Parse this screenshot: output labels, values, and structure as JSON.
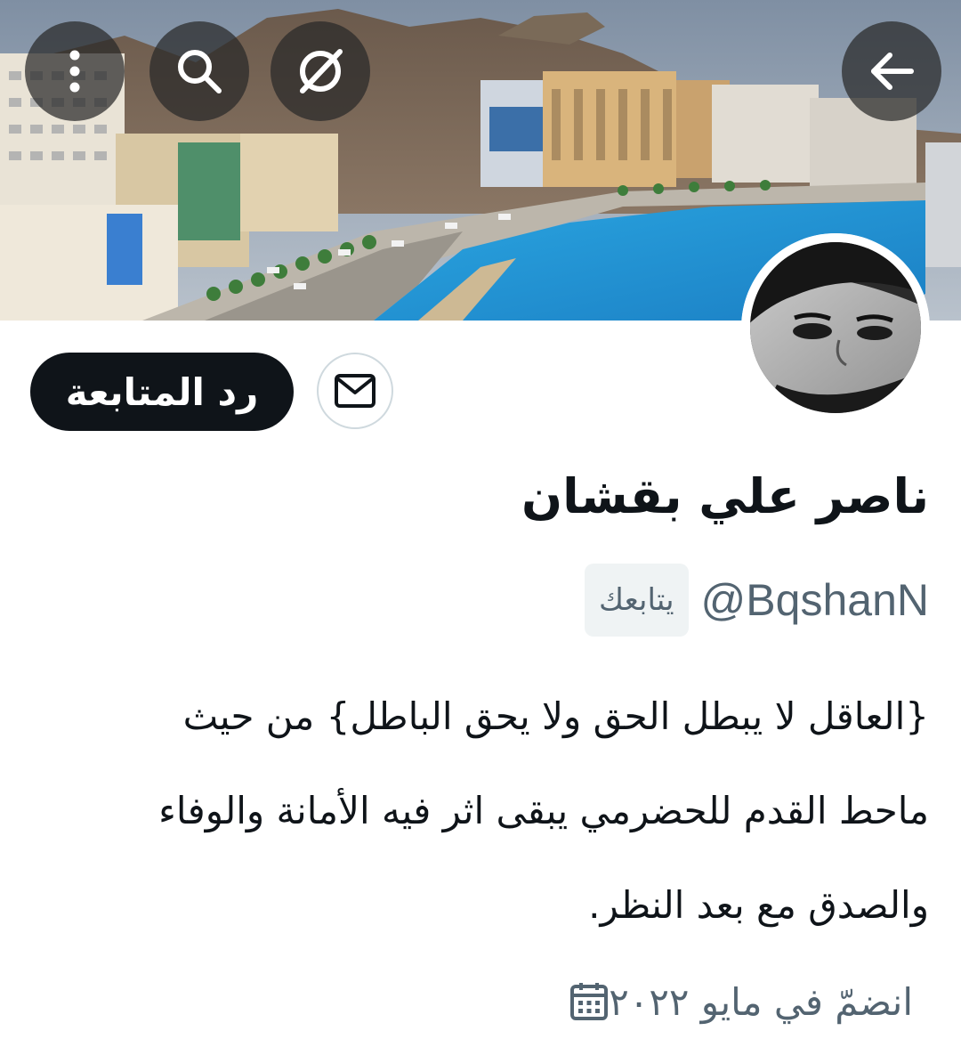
{
  "header": {
    "back_icon": "arrow-left-icon",
    "mute_icon": "mute-icon",
    "search_icon": "search-icon",
    "more_icon": "more-vertical-icon"
  },
  "banner": {
    "description_icon": "city-coastline-banner"
  },
  "actions": {
    "follow_back_label": "رد المتابعة",
    "message_icon": "mail-icon"
  },
  "profile": {
    "display_name": "ناصر علي بقشان",
    "handle": "@BqshanN",
    "follows_you_label": "يتابعك",
    "bio_lines": [
      "{العاقل لا يبطل الحق ولا يحق الباطل} من حيث",
      "ماحط القدم للحضرمي يبقى اثر فيه الأمانة والوفاء",
      "والصدق مع بعد النظر."
    ],
    "joined": "انضمّ في مايو ٢٠٢٢",
    "joined_icon": "calendar-icon"
  },
  "colors": {
    "primary_text": "#0f1419",
    "secondary_text": "#536471",
    "button_dark": "#0f1419",
    "border": "#cfd9de",
    "badge_bg": "#eff3f4"
  }
}
